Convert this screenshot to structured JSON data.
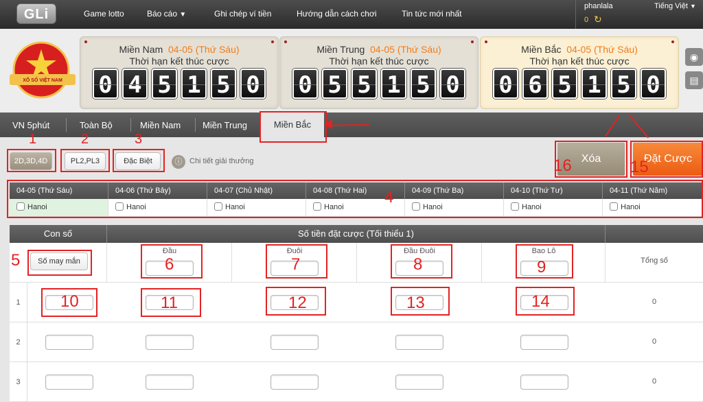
{
  "header": {
    "logo_text": "GLi",
    "nav": [
      "Game lotto",
      "Báo cáo",
      "Ghi chép ví tiền",
      "Hướng dẫn cách chơi",
      "Tin tức mới nhất"
    ],
    "username": "phanlala",
    "balance": "0",
    "language": "Tiếng Việt"
  },
  "emblem": {
    "text": "XỔ SỐ VIỆT NAM"
  },
  "panels": [
    {
      "region": "Miền Nam",
      "date": "04-05 (Thứ Sáu)",
      "subtitle": "Thời hạn kết thúc cược",
      "digits": [
        "0",
        "4",
        "5",
        "1",
        "5",
        "0"
      ]
    },
    {
      "region": "Miền Trung",
      "date": "04-05 (Thứ Sáu)",
      "subtitle": "Thời hạn kết thúc cược",
      "digits": [
        "0",
        "5",
        "5",
        "1",
        "5",
        "0"
      ]
    },
    {
      "region": "Miền Bắc",
      "date": "04-05 (Thứ Sáu)",
      "subtitle": "Thời hạn kết thúc cược",
      "digits": [
        "0",
        "6",
        "5",
        "1",
        "5",
        "0"
      ]
    }
  ],
  "tabs": [
    "VN 5phút",
    "Toàn Bộ",
    "Miền Nam",
    "Miền Trung",
    "Miền Bắc"
  ],
  "bet_types": [
    "2D,3D,4D",
    "PL2,PL3",
    "Đặc Biệt"
  ],
  "prize_detail": "Chi tiết giải thưởng",
  "actions": {
    "clear": "Xóa",
    "place_bet": "Đặt Cược"
  },
  "dates": [
    {
      "date": "04-05 (Thứ Sáu)",
      "city": "Hanoi"
    },
    {
      "date": "04-06 (Thứ Bảy)",
      "city": "Hanoi"
    },
    {
      "date": "04-07 (Chủ Nhật)",
      "city": "Hanoi"
    },
    {
      "date": "04-08 (Thứ Hai)",
      "city": "Hanoi"
    },
    {
      "date": "04-09 (Thứ Ba)",
      "city": "Hanoi"
    },
    {
      "date": "04-10 (Thứ Tư)",
      "city": "Hanoi"
    },
    {
      "date": "04-11 (Thứ Năm)",
      "city": "Hanoi"
    }
  ],
  "grid": {
    "col_number": "Con số",
    "col_amount": "Số tiền đặt cược (Tối thiểu 1)",
    "lucky_button": "Số may mắn",
    "sub_cols": [
      "Đầu",
      "Đuôi",
      "Đầu Đuôi",
      "Bao Lô"
    ],
    "total_label": "Tổng số",
    "rows": [
      {
        "no": "1",
        "total": "0"
      },
      {
        "no": "2",
        "total": "0"
      },
      {
        "no": "3",
        "total": "0"
      }
    ]
  },
  "annotations": [
    "1",
    "2",
    "3",
    "4",
    "5",
    "6",
    "7",
    "8",
    "9",
    "10",
    "11",
    "12",
    "13",
    "14",
    "15",
    "16"
  ],
  "colors": {
    "accent_orange": "#f07c1a",
    "annotation_red": "#e32222",
    "dark_bar": "#4e4e4e"
  }
}
